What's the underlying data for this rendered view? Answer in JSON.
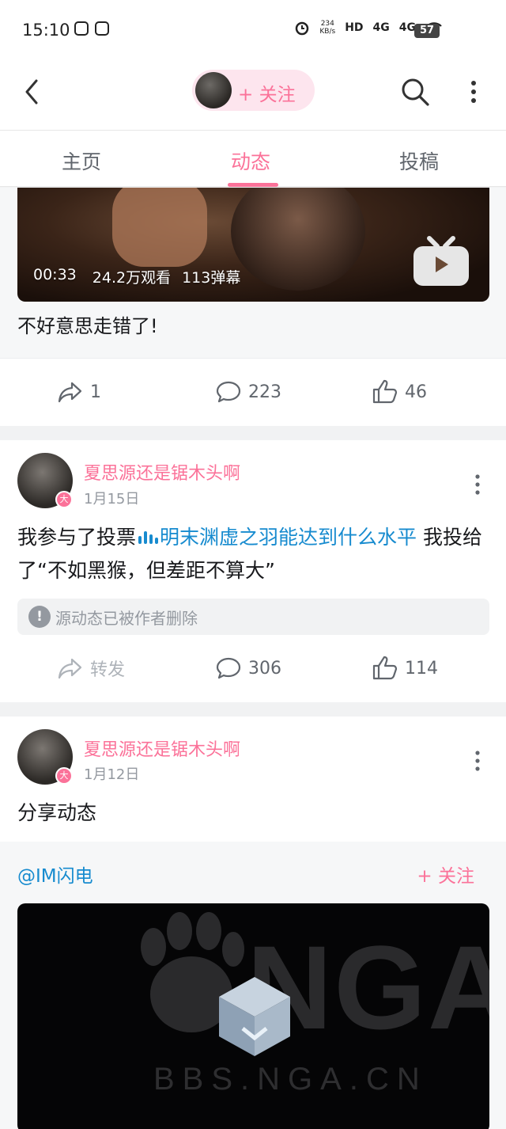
{
  "status_bar": {
    "time": "15:10",
    "net_speed_value": "234",
    "net_speed_unit": "KB/s",
    "hd": "HD",
    "signal1": "4G",
    "signal2": "4G",
    "battery": "57"
  },
  "nav": {
    "follow_label": "+ 关注"
  },
  "tabs": [
    {
      "label": "主页"
    },
    {
      "label": "动态"
    },
    {
      "label": "投稿"
    }
  ],
  "active_tab": "动态",
  "post1": {
    "duration": "00:33",
    "views": "24.2万观看",
    "danmaku": "113弹幕",
    "title": "不好意思走错了!",
    "shares": "1",
    "comments": "223",
    "likes": "46"
  },
  "post2": {
    "author": "夏思源还是锯木头啊",
    "date": "1月15日",
    "badge": "大",
    "text_prefix": "我参与了投票",
    "vote_title": "明末渊虚之羽能达到什么水平",
    "text_suffix": " 我投给了“不如黑猴，但差距不算大”",
    "deleted_notice": "源动态已被作者删除",
    "forward_label": "转发",
    "comments": "306",
    "likes": "114"
  },
  "post3": {
    "author": "夏思源还是锯木头啊",
    "date": "1月12日",
    "badge": "大",
    "text": "分享动态",
    "shared_author": "@IM闪电",
    "shared_follow": "+ 关注",
    "video_watermark": "NGA",
    "video_url_text": "BBS.NGA.CN"
  },
  "colors": {
    "accent": "#fb7299",
    "link": "#178bcf",
    "muted": "#9499a0"
  }
}
